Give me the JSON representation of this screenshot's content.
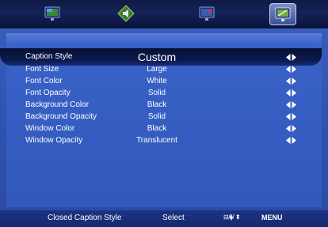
{
  "tabs": [
    {
      "icon": "monitor-picture-icon"
    },
    {
      "icon": "audio-settings-icon"
    },
    {
      "icon": "channel-monitor-icon"
    },
    {
      "icon": "setup-monitor-icon",
      "selected": true
    }
  ],
  "menu": {
    "rows": [
      {
        "label": "Caption Style",
        "value": "Custom"
      },
      {
        "label": "Font Size",
        "value": "Large"
      },
      {
        "label": "Font Color",
        "value": "White"
      },
      {
        "label": "Font Opacity",
        "value": "Solid"
      },
      {
        "label": "Background Color",
        "value": "Black"
      },
      {
        "label": "Background Opacity",
        "value": "Solid"
      },
      {
        "label": "Window Color",
        "value": "Black"
      },
      {
        "label": "Window Opacity",
        "value": "Translucent"
      }
    ]
  },
  "footer": {
    "title": "Closed Caption Style",
    "select": "Select",
    "nav": "⊟/⧫/ ⬍",
    "menu": "MENU"
  },
  "colors": {
    "accent": "#3158ba",
    "highlight": "#0b1a4f",
    "arrow": "#ffffff"
  }
}
